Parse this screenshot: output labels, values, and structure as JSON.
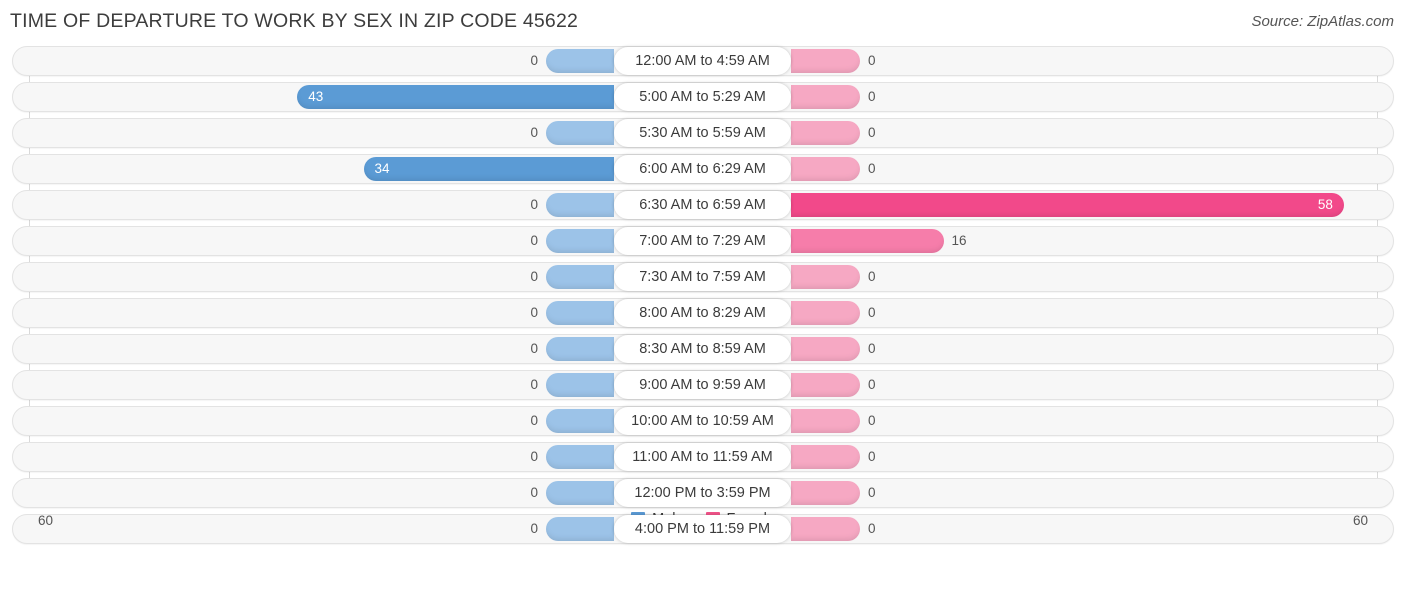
{
  "header": {
    "title": "TIME OF DEPARTURE TO WORK BY SEX IN ZIP CODE 45622",
    "source": "Source: ZipAtlas.com"
  },
  "legend": {
    "male_label": "Male",
    "female_label": "Female",
    "male_color": "#5b9bd5",
    "female_color": "#f2548a"
  },
  "axis": {
    "left_tick": "60",
    "right_tick": "60"
  },
  "chart_data": {
    "type": "bar",
    "title": "TIME OF DEPARTURE TO WORK BY SEX IN ZIP CODE 45622",
    "subtitle": "Source: ZipAtlas.com",
    "orientation": "horizontal-diverging",
    "xlabel": "",
    "ylabel": "",
    "xlim": [
      60,
      60
    ],
    "grid": true,
    "legend_position": "bottom-center",
    "categories": [
      "12:00 AM to 4:59 AM",
      "5:00 AM to 5:29 AM",
      "5:30 AM to 5:59 AM",
      "6:00 AM to 6:29 AM",
      "6:30 AM to 6:59 AM",
      "7:00 AM to 7:29 AM",
      "7:30 AM to 7:59 AM",
      "8:00 AM to 8:29 AM",
      "8:30 AM to 8:59 AM",
      "9:00 AM to 9:59 AM",
      "10:00 AM to 10:59 AM",
      "11:00 AM to 11:59 AM",
      "12:00 PM to 3:59 PM",
      "4:00 PM to 11:59 PM"
    ],
    "series": [
      {
        "name": "Male",
        "color": "#5b9bd5",
        "values": [
          0,
          43,
          0,
          34,
          0,
          0,
          0,
          0,
          0,
          0,
          0,
          0,
          0,
          0
        ]
      },
      {
        "name": "Female",
        "color": "#f2548a",
        "values": [
          0,
          0,
          0,
          0,
          58,
          16,
          0,
          0,
          0,
          0,
          0,
          0,
          0,
          0
        ]
      }
    ]
  },
  "rows": [
    {
      "category": "12:00 AM to 4:59 AM",
      "male": "0",
      "female": "0"
    },
    {
      "category": "5:00 AM to 5:29 AM",
      "male": "43",
      "female": "0"
    },
    {
      "category": "5:30 AM to 5:59 AM",
      "male": "0",
      "female": "0"
    },
    {
      "category": "6:00 AM to 6:29 AM",
      "male": "34",
      "female": "0"
    },
    {
      "category": "6:30 AM to 6:59 AM",
      "male": "0",
      "female": "58"
    },
    {
      "category": "7:00 AM to 7:29 AM",
      "male": "0",
      "female": "16"
    },
    {
      "category": "7:30 AM to 7:59 AM",
      "male": "0",
      "female": "0"
    },
    {
      "category": "8:00 AM to 8:29 AM",
      "male": "0",
      "female": "0"
    },
    {
      "category": "8:30 AM to 8:59 AM",
      "male": "0",
      "female": "0"
    },
    {
      "category": "9:00 AM to 9:59 AM",
      "male": "0",
      "female": "0"
    },
    {
      "category": "10:00 AM to 10:59 AM",
      "male": "0",
      "female": "0"
    },
    {
      "category": "11:00 AM to 11:59 AM",
      "male": "0",
      "female": "0"
    },
    {
      "category": "12:00 PM to 3:59 PM",
      "male": "0",
      "female": "0"
    },
    {
      "category": "4:00 PM to 11:59 PM",
      "male": "0",
      "female": "0"
    }
  ]
}
